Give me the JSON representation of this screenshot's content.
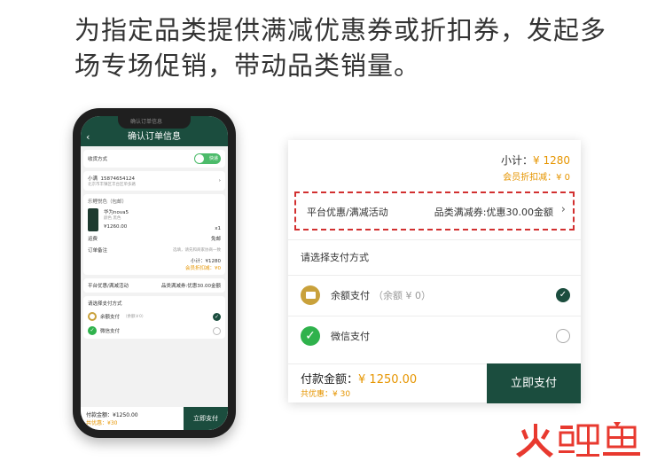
{
  "headline": "为指定品类提供满减优惠券或折扣券，发起多场专场促销，带动品类销量。",
  "phone": {
    "notch_text": "确认订单信息",
    "nav_title": "确认订单信息",
    "back": "‹",
    "delivery_label": "收货方式",
    "toggle_text": "快递",
    "contact_name": "小满",
    "contact_phone": "15874654124",
    "address": "北京市丰镇区丰台区单多路",
    "store": "乐鲤悦色（包邮）",
    "product_name": "华为nova5",
    "product_spec": "颜色 黑色",
    "product_price": "¥1260.00",
    "product_qty": "x1",
    "shipping_label": "运费",
    "shipping_value": "免邮",
    "remark_label": "订单备注",
    "remark_placeholder": "选填，请先和商家协商一致",
    "subtotal": "小计：¥1280",
    "member_discount": "会员折扣减：¥0",
    "promo_label": "平台优惠/满减活动",
    "promo_value": "品类满减券:优惠30.00金额",
    "pay_title": "请选择支付方式",
    "pay_balance": "余额支付",
    "pay_balance_hint": "（余额￥0）",
    "pay_wechat": "微信支付",
    "total": "付款金额：¥1250.00",
    "saved": "共优惠：¥30",
    "pay_button": "立即支付"
  },
  "card": {
    "subtotal_label": "小计：",
    "subtotal_amount": "¥ 1280",
    "member_discount": "会员折扣减：¥ 0",
    "promo_label": "平台优惠/满减活动",
    "promo_value": "品类满减券:优惠30.00金额",
    "chevron": "›",
    "pay_title": "请选择支付方式",
    "pay_options": [
      {
        "label": "余额支付",
        "hint": "（余额 ¥ 0）",
        "selected": true,
        "icon": "wallet-icon"
      },
      {
        "label": "微信支付",
        "hint": "",
        "selected": false,
        "icon": "wechat-pay-icon"
      }
    ],
    "total_label": "付款金额：",
    "total_amount": "¥ 1250.00",
    "saved": "共优惠：¥ 30",
    "pay_button": "立即支付"
  },
  "logo": {
    "text": "火鲤鱼",
    "colors": {
      "fire": "#e8392f",
      "li": "#e8392f",
      "yu": "#e8392f"
    }
  },
  "colors": {
    "primary": "#1b4d3e",
    "accent_orange": "#e69500",
    "dashed_highlight": "#d23030",
    "wechat_green": "#2fb24c",
    "balance_gold": "#c9a13b"
  }
}
